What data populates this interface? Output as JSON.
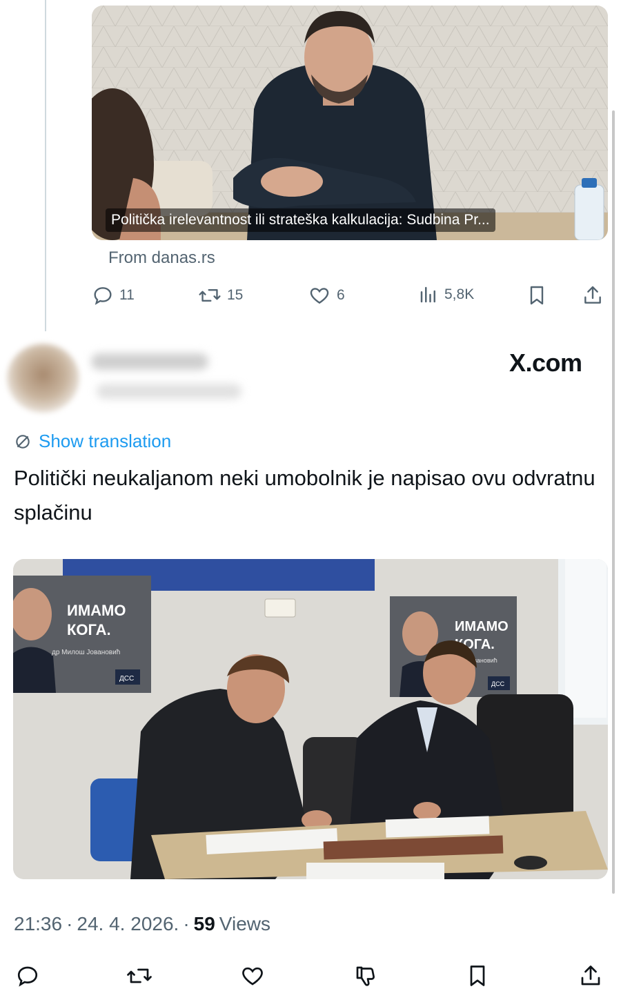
{
  "quoted_card": {
    "caption": "Politička irelevantnost ili strateška kalkulacija: Sudbina Pr...",
    "source": "From danas.rs",
    "stats": {
      "replies": "11",
      "reposts": "15",
      "likes": "6",
      "views": "5,8K"
    }
  },
  "watermark": "X.com",
  "tweet": {
    "show_translation": "Show translation",
    "text": "Politički neukaljanom neki umobolnik je napisao ovu odvratnu splačinu",
    "photo": {
      "poster_left": {
        "headline_1": "ИМАМО",
        "headline_2": "КОГА.",
        "name": "др Милош Јовановић",
        "party": "ДСС"
      },
      "poster_right": {
        "headline_1": "ИМАМО",
        "headline_2": "КОГА.",
        "name": "ш Јовановић",
        "party": "ДСС"
      }
    },
    "time": "21:36",
    "date": "24. 4. 2026.",
    "view_count": "59",
    "views_label": "Views"
  }
}
